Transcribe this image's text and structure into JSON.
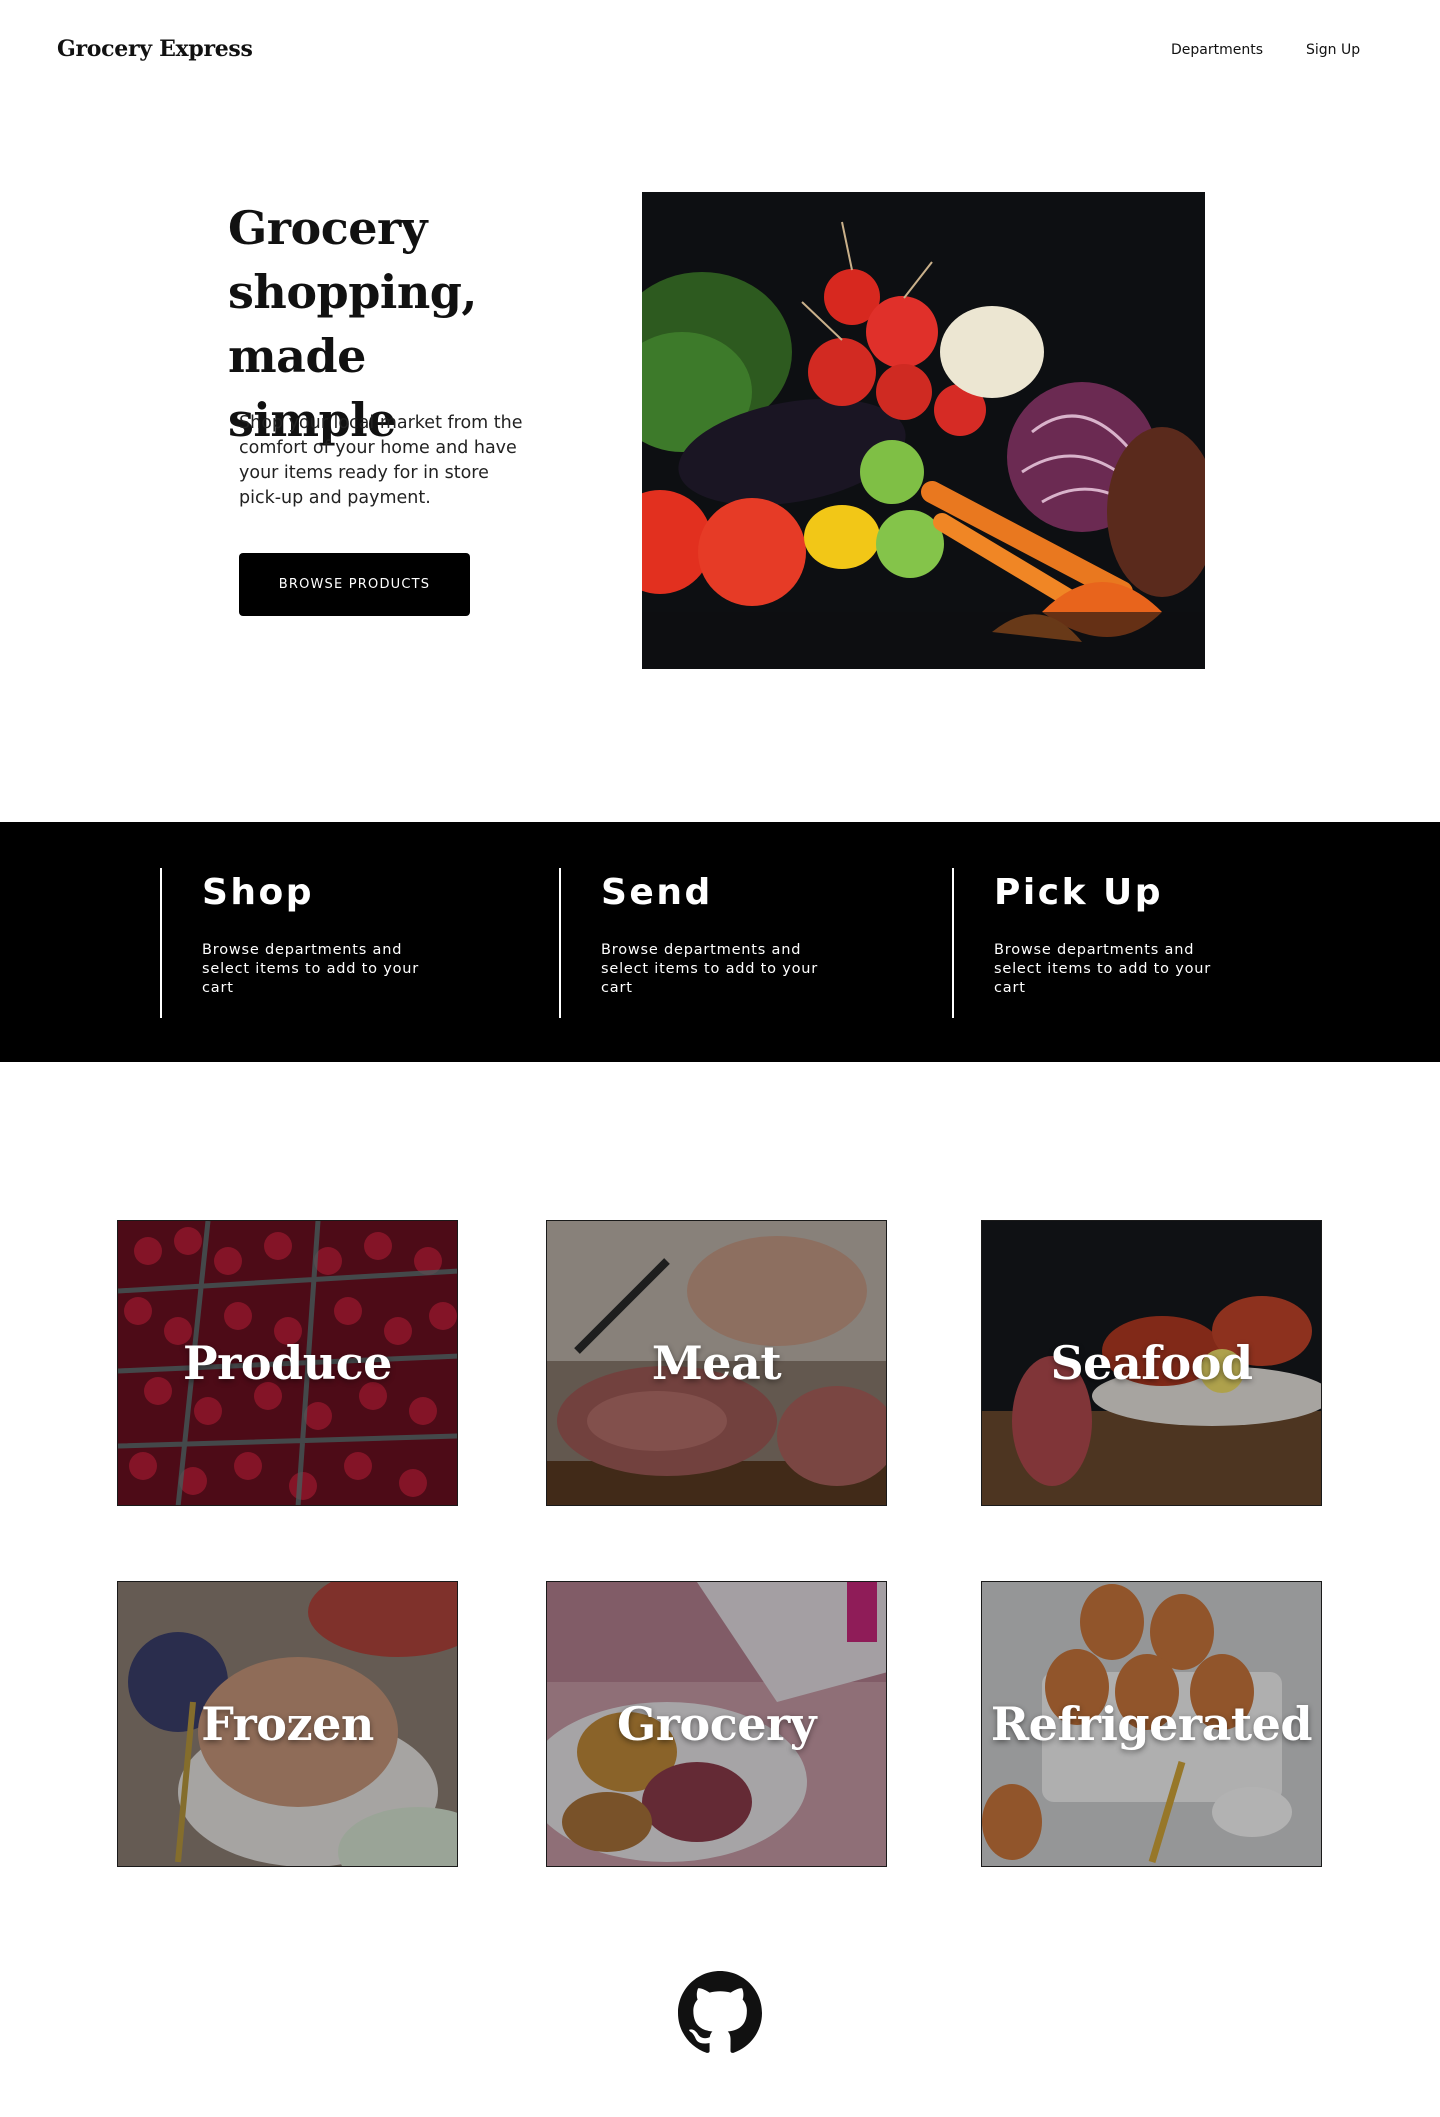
{
  "header": {
    "brand": "Grocery Express",
    "nav": [
      "Departments",
      "Sign Up"
    ]
  },
  "hero": {
    "title_lines": [
      "Grocery",
      "shopping,",
      "made simple"
    ],
    "description": "Shop your local market from the comfort of your home and have your items ready for in store pick-up and payment.",
    "cta_label": "BROWSE PRODUCTS",
    "image": "vegetables-still-life"
  },
  "steps": [
    {
      "title": "Shop",
      "description": "Browse departments and select items to add to your cart"
    },
    {
      "title": "Send",
      "description": "Browse departments and select items to add to your cart"
    },
    {
      "title": "Pick Up",
      "description": "Browse departments and select items to add to your cart"
    }
  ],
  "departments": [
    {
      "label": "Produce",
      "image": "raspberries"
    },
    {
      "label": "Meat",
      "image": "sliced-meat"
    },
    {
      "label": "Seafood",
      "image": "lobster-plate"
    },
    {
      "label": "Frozen",
      "image": "ice-cream-bowl"
    },
    {
      "label": "Grocery",
      "image": "chips-bag"
    },
    {
      "label": "Refrigerated",
      "image": "eggs-carton"
    }
  ],
  "footer": {
    "icon": "github-icon"
  }
}
